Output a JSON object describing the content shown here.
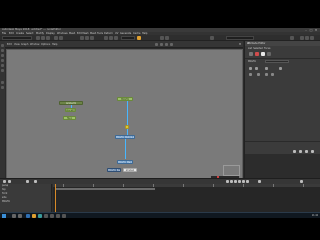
{
  "window": {
    "title": "Autodesk Maya 2018: untitled* --- nodeEditor",
    "controls": {
      "minimize": "–",
      "maximize": "□",
      "close": "✕"
    }
  },
  "menubar": [
    "File",
    "Edit",
    "Create",
    "Select",
    "Modify",
    "Display",
    "Windows",
    "Mesh",
    "Edit Mesh",
    "Mesh Tools",
    "Deform",
    "UV",
    "Generate",
    "Cache",
    "Help"
  ],
  "node_editor": {
    "title": "Node Editor",
    "menus": [
      "Edit",
      "View",
      "Graph",
      "Window",
      "Options",
      "Help"
    ],
    "nodes": {
      "top_left": "lambert1",
      "mid_left_a": "place2d",
      "mid_left_b": "file1",
      "top_center": "MASH1",
      "center_a": "MASH1_Distribute",
      "center_b": "MASH1_Waiter",
      "bottom_a": "MASH1_Repro",
      "bottom_b": "pCube1"
    }
  },
  "attribute_editor": {
    "title": "Attribute Editor",
    "tabs": [
      "List",
      "Selected",
      "Focus",
      "Attributes",
      "Show",
      "Help"
    ],
    "rows": [
      "MASH1",
      "Presets",
      "Show",
      "Hide"
    ]
  },
  "timeline": {
    "outliner_rows": [
      "persp",
      "top",
      "front",
      "side",
      "MASH1"
    ],
    "selected_row": "MASH1",
    "start_frame": "1",
    "end_frame": "120"
  },
  "taskbar": {
    "time": "11:42",
    "date": "2018/05/14"
  },
  "colors": {
    "graph_bg": "#7a7a7a",
    "edge": "#48b7ff",
    "node_green": "#9ec16a",
    "node_blue": "#5f8fbf",
    "playhead": "#d88a28",
    "accent_orange": "#e0a030"
  }
}
